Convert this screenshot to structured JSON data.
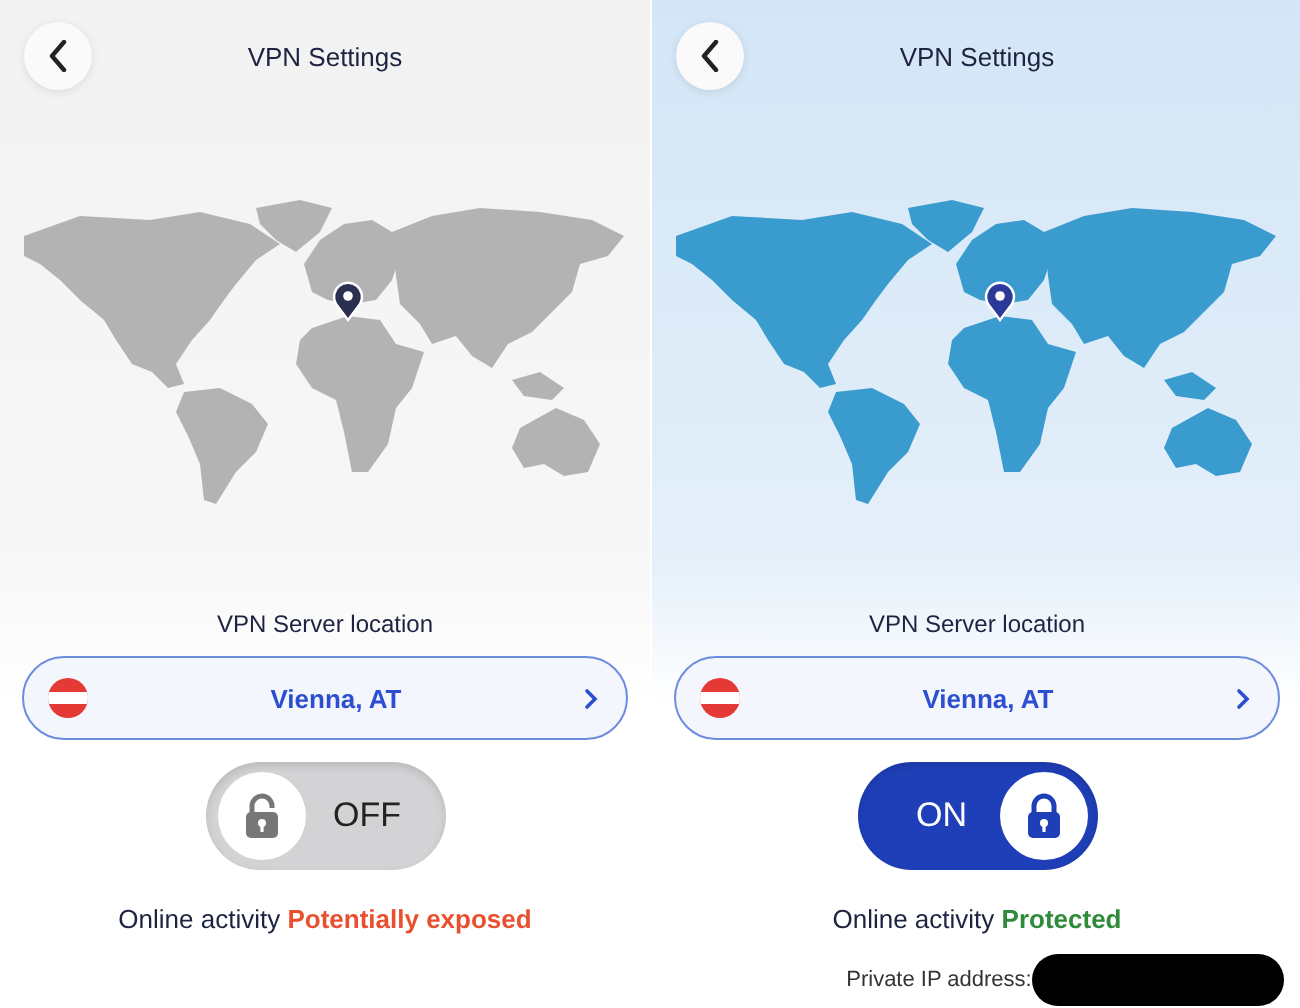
{
  "panels": [
    {
      "title": "VPN Settings",
      "connected": false,
      "server_label": "VPN Server location",
      "location": "Vienna, AT",
      "toggle_label": "OFF",
      "status_label": "Online activity",
      "status_value": "Potentially exposed"
    },
    {
      "title": "VPN Settings",
      "connected": true,
      "server_label": "VPN Server location",
      "location": "Vienna, AT",
      "toggle_label": "ON",
      "status_label": "Online activity",
      "status_value": "Protected",
      "ip_label": "Private IP address:"
    }
  ]
}
